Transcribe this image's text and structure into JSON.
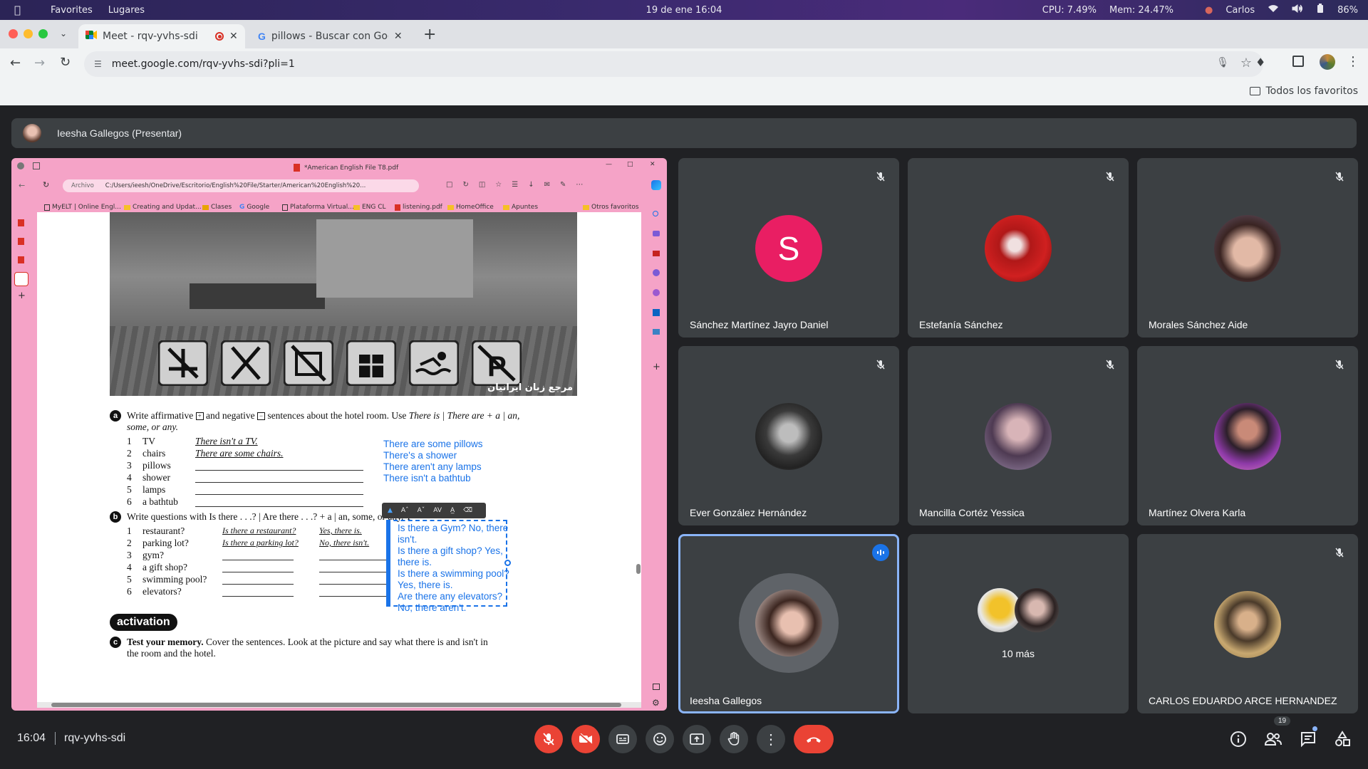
{
  "menubar": {
    "favorites": "Favorites",
    "places": "Lugares",
    "datetime": "19 de ene  16:04",
    "cpu": "CPU: 7.49%",
    "mem": "Mem: 24.47%",
    "user": "Carlos",
    "battery": "86%"
  },
  "tabs": [
    {
      "title": "Meet - rqv-yvhs-sdi"
    },
    {
      "title": "pillows - Buscar con Goo"
    }
  ],
  "address": {
    "url": "meet.google.com/rqv-yvhs-sdi?pli=1"
  },
  "bookmarks": {
    "all": "Todos los favoritos"
  },
  "presenter": {
    "label": "Ieesha Gallegos (Presentar)"
  },
  "shared": {
    "pdf_title": "*American English File T8.pdf",
    "address_prefix": "Archivo",
    "address": "C:/Users/ieesh/OneDrive/Escritorio/English%20File/Starter/American%20English%20...",
    "bookmarks": [
      "MyELT | Online Engl...",
      "Creating and Updat...",
      "Clases",
      "Google",
      "Plataforma Virtual...",
      "ENG CL",
      "listening.pdf",
      "HomeOffice",
      "Apuntes",
      "Otros favoritos"
    ],
    "watermark": "مرجع زبان ایرانیان",
    "exercise_a": {
      "letter": "a",
      "instruction_1": "Write affirmative",
      "instruction_2": "and negative",
      "instruction_3": "sentences about the hotel room. Use",
      "instruction_4": "There is | There are + a | an,",
      "instruction_5": "some, or any.",
      "items": [
        {
          "n": "1",
          "word": "TV",
          "answer": "There isn't a TV."
        },
        {
          "n": "2",
          "word": "chairs",
          "answer": "There are some chairs."
        },
        {
          "n": "3",
          "word": "pillows",
          "answer": ""
        },
        {
          "n": "4",
          "word": "shower",
          "answer": ""
        },
        {
          "n": "5",
          "word": "lamps",
          "answer": ""
        },
        {
          "n": "6",
          "word": "a bathtub",
          "answer": ""
        }
      ],
      "typed": [
        "There are some pillows",
        "There's a shower",
        "There aren't any lamps",
        "There isn't a bathtub"
      ]
    },
    "exercise_b": {
      "letter": "b",
      "instruction": "Write questions with Is there . . .? | Are there . . .? + a | an, some, or any. T",
      "items": [
        {
          "n": "1",
          "word": "restaurant?",
          "q": "Is there a restaurant?",
          "a": "Yes, there is."
        },
        {
          "n": "2",
          "word": "parking lot?",
          "q": "Is there a parking lot?",
          "a": "No, there isn't."
        },
        {
          "n": "3",
          "word": "gym?",
          "q": "",
          "a": ""
        },
        {
          "n": "4",
          "word": "a gift shop?",
          "q": "",
          "a": ""
        },
        {
          "n": "5",
          "word": "swimming pool?",
          "q": "",
          "a": ""
        },
        {
          "n": "6",
          "word": "elevators?",
          "q": "",
          "a": ""
        }
      ],
      "typed": [
        "Is there a Gym? No, there",
        "isn't.",
        "Is there a gift shop? Yes,",
        "there is.",
        "Is there a swimming pool?",
        "Yes, there is.",
        "Are there any elevators?",
        "No, there aren't."
      ]
    },
    "activation": "activation",
    "exercise_c": {
      "letter": "c",
      "line1_bold": "Test your memory.",
      "line1": "Cover the sentences. Look at the picture and say what there is and isn't in",
      "line2": "the room and the hotel."
    }
  },
  "tiles": [
    {
      "name": "Sánchez Martínez Jayro Daniel",
      "initial": "S",
      "color": "#e91e63"
    },
    {
      "name": "Estefanía Sánchez"
    },
    {
      "name": "Morales Sánchez Aide"
    },
    {
      "name": "Ever González Hernández"
    },
    {
      "name": "Mancilla Cortéz Yessica"
    },
    {
      "name": "Martínez Olvera Karla"
    },
    {
      "name": "Ieesha Gallegos"
    },
    {
      "name": "",
      "more": "10 más"
    },
    {
      "name": "CARLOS EDUARDO ARCE HERNANDEZ"
    }
  ],
  "bottom": {
    "time": "16:04",
    "meeting_code": "rqv-yvhs-sdi",
    "participants_badge": "19"
  },
  "colors": {
    "accent_red": "#ea4335",
    "share_frame": "#f5a3c7",
    "speaking_border": "#8ab4f8",
    "link_blue": "#1a73e8"
  }
}
